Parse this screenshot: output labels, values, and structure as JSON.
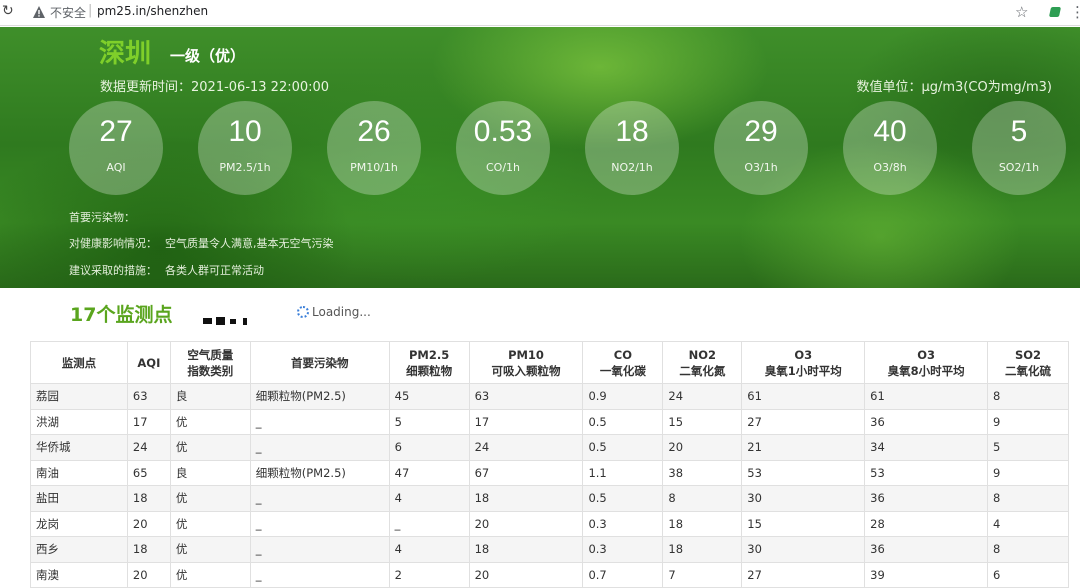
{
  "browser": {
    "security_label": "不安全",
    "url": "pm25.in/shenzhen"
  },
  "header": {
    "city": "深圳",
    "grade": "一级（优）",
    "updated": "数据更新时间：2021-06-13 22:00:00",
    "unit": "数值单位：μg/m3(CO为mg/m3)"
  },
  "metrics": [
    {
      "value": "27",
      "label": "AQI"
    },
    {
      "value": "10",
      "label": "PM2.5/1h"
    },
    {
      "value": "26",
      "label": "PM10/1h"
    },
    {
      "value": "0.53",
      "label": "CO/1h"
    },
    {
      "value": "18",
      "label": "NO2/1h"
    },
    {
      "value": "29",
      "label": "O3/1h"
    },
    {
      "value": "40",
      "label": "O3/8h"
    },
    {
      "value": "5",
      "label": "SO2/1h"
    }
  ],
  "info": {
    "primary_label": "首要污染物：",
    "primary_value": "",
    "health_label": "对健康影响情况：",
    "health_value": "空气质量令人满意,基本无空气污染",
    "advice_label": "建议采取的措施：",
    "advice_value": "各类人群可正常活动"
  },
  "section": {
    "title": "17个监测点",
    "loading": "Loading..."
  },
  "table": {
    "headers": [
      {
        "line1": "监测点",
        "line2": ""
      },
      {
        "line1": "AQI",
        "line2": ""
      },
      {
        "line1": "空气质量",
        "line2": "指数类别"
      },
      {
        "line1": "首要污染物",
        "line2": ""
      },
      {
        "line1": "PM2.5",
        "line2": "细颗粒物"
      },
      {
        "line1": "PM10",
        "line2": "可吸入颗粒物"
      },
      {
        "line1": "CO",
        "line2": "一氧化碳"
      },
      {
        "line1": "NO2",
        "line2": "二氧化氮"
      },
      {
        "line1": "O3",
        "line2": "臭氧1小时平均"
      },
      {
        "line1": "O3",
        "line2": "臭氧8小时平均"
      },
      {
        "line1": "SO2",
        "line2": "二氧化硫"
      }
    ],
    "rows": [
      [
        "荔园",
        "63",
        "良",
        "细颗粒物(PM2.5)",
        "45",
        "63",
        "0.9",
        "24",
        "61",
        "61",
        "8"
      ],
      [
        "洪湖",
        "17",
        "优",
        "_",
        "5",
        "17",
        "0.5",
        "15",
        "27",
        "36",
        "9"
      ],
      [
        "华侨城",
        "24",
        "优",
        "_",
        "6",
        "24",
        "0.5",
        "20",
        "21",
        "34",
        "5"
      ],
      [
        "南油",
        "65",
        "良",
        "细颗粒物(PM2.5)",
        "47",
        "67",
        "1.1",
        "38",
        "53",
        "53",
        "9"
      ],
      [
        "盐田",
        "18",
        "优",
        "_",
        "4",
        "18",
        "0.5",
        "8",
        "30",
        "36",
        "8"
      ],
      [
        "龙岗",
        "20",
        "优",
        "_",
        "_",
        "20",
        "0.3",
        "18",
        "15",
        "28",
        "4"
      ],
      [
        "西乡",
        "18",
        "优",
        "_",
        "4",
        "18",
        "0.3",
        "18",
        "30",
        "36",
        "8"
      ],
      [
        "南澳",
        "20",
        "优",
        "_",
        "2",
        "20",
        "0.7",
        "7",
        "27",
        "39",
        "6"
      ]
    ]
  }
}
